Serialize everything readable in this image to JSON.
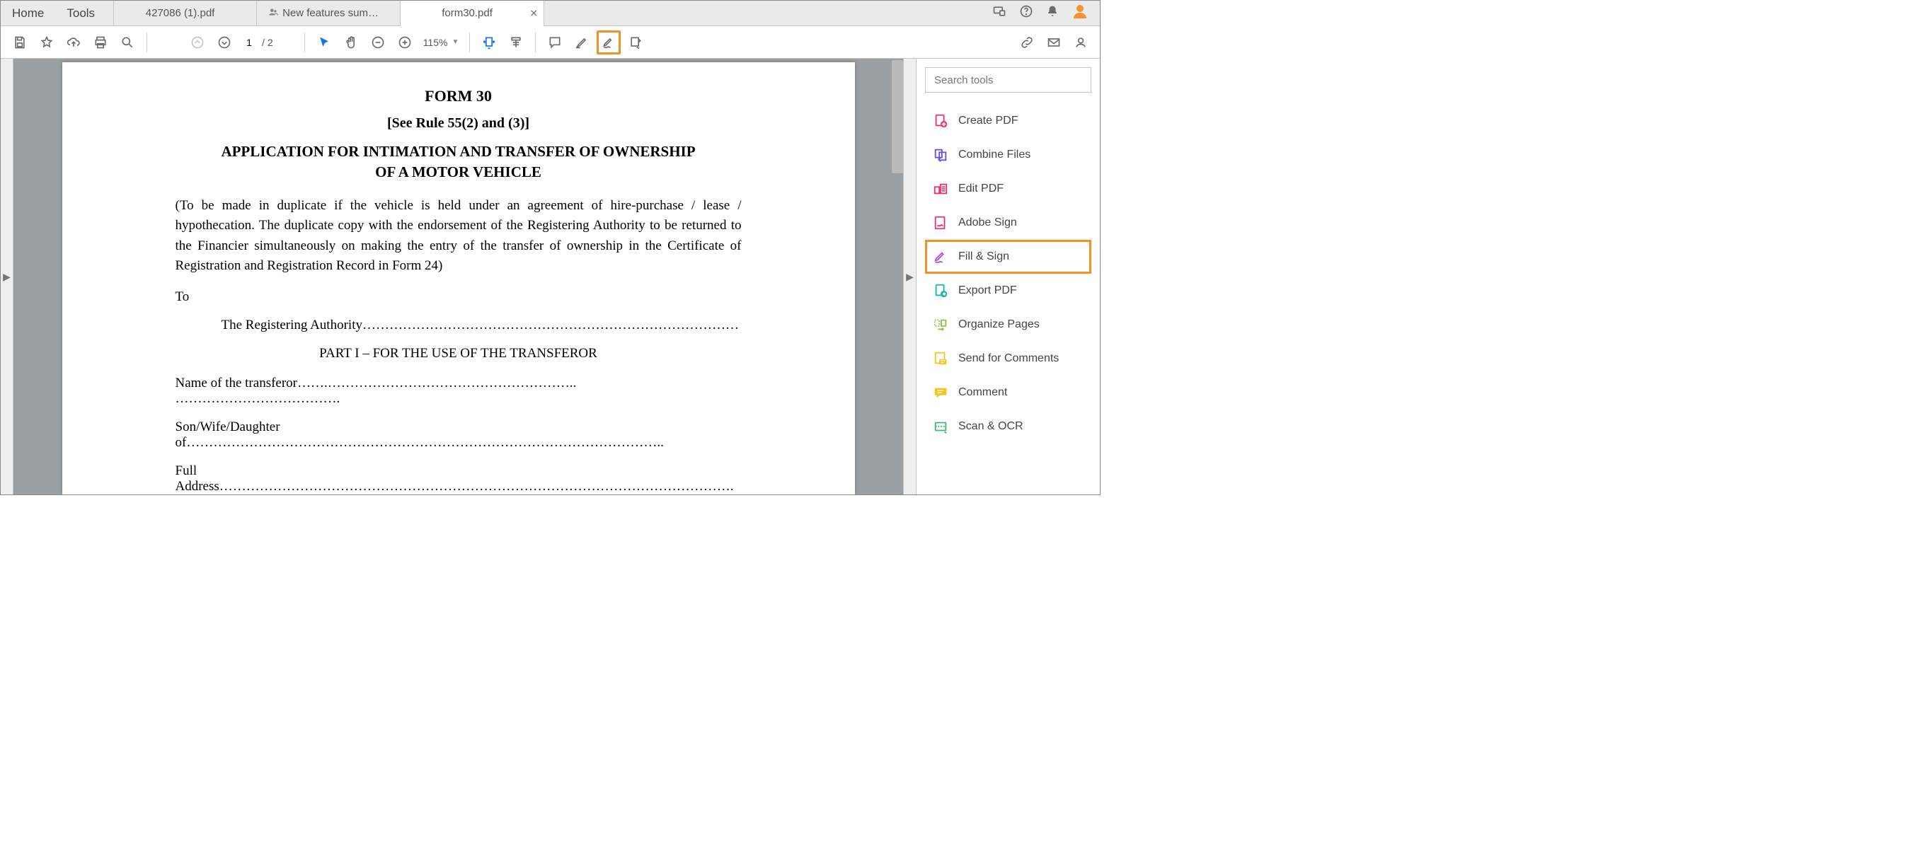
{
  "menu": {
    "home": "Home",
    "tools": "Tools"
  },
  "tabs": [
    {
      "label": "427086 (1).pdf",
      "active": false,
      "icon": false
    },
    {
      "label": "New features sum…",
      "active": false,
      "icon": true
    },
    {
      "label": "form30.pdf",
      "active": true,
      "icon": false
    }
  ],
  "toolbar": {
    "current_page": "1",
    "page_sep": "/",
    "total_pages": "2",
    "zoom": "115%"
  },
  "right_panel": {
    "search_placeholder": "Search tools",
    "items": [
      {
        "label": "Create PDF",
        "color": "#e8336d",
        "icon": "create"
      },
      {
        "label": "Combine Files",
        "color": "#6b4de6",
        "icon": "combine"
      },
      {
        "label": "Edit PDF",
        "color": "#e8336d",
        "icon": "edit"
      },
      {
        "label": "Adobe Sign",
        "color": "#e8336d",
        "icon": "adobesign"
      },
      {
        "label": "Fill & Sign",
        "color": "#b152d1",
        "icon": "fill",
        "highlight": true
      },
      {
        "label": "Export PDF",
        "color": "#17b4a8",
        "icon": "export"
      },
      {
        "label": "Organize Pages",
        "color": "#8bc34a",
        "icon": "organize"
      },
      {
        "label": "Send for Comments",
        "color": "#f5c518",
        "icon": "send"
      },
      {
        "label": "Comment",
        "color": "#f5c518",
        "icon": "comment"
      },
      {
        "label": "Scan & OCR",
        "color": "#3fb76b",
        "icon": "scan"
      }
    ]
  },
  "document": {
    "h1": "FORM 30",
    "h2": "[See Rule 55(2) and (3)]",
    "title2_l1": "APPLICATION FOR INTIMATION AND TRANSFER OF OWNERSHIP",
    "title2_l2": "OF A MOTOR VEHICLE",
    "para": "(To be made in duplicate if the vehicle is held under an agreement of hire-purchase / lease / hypothecation. The duplicate copy with the endorsement of the Registering Authority to be returned to the Financier simultaneously on making the entry of the transfer of ownership in the Certificate of Registration and Registration Record in Form 24)",
    "to": "To",
    "reg_auth": "The Registering Authority…………………………………………………………………………",
    "part1": "PART I – FOR THE USE OF THE TRANSFEROR",
    "line1": "Name of the transferor…….……………………………………………….. ……………………………….",
    "line2": "Son/Wife/Daughter of……………………………………………………………………………………………..",
    "line3": "Full Address…………………………………………………………………………………………………….",
    "line4": "………………………………………………………………………………………………………………………"
  }
}
